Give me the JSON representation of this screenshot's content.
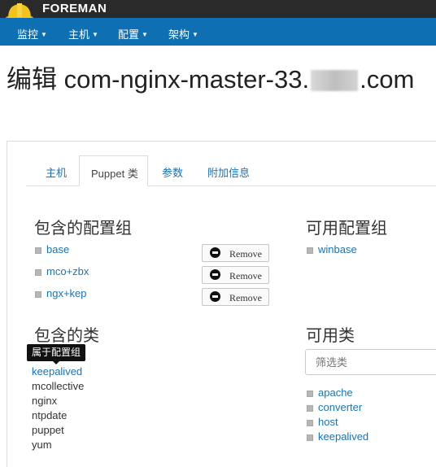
{
  "brand": {
    "name": "FOREMAN",
    "logo_icon": "hardhat-logo-icon"
  },
  "nav": {
    "items": [
      {
        "label": "监控"
      },
      {
        "label": "主机"
      },
      {
        "label": "配置"
      },
      {
        "label": "架构"
      }
    ],
    "caret": "▼"
  },
  "page": {
    "title_prefix": "编辑 com-nginx-master-33.",
    "title_suffix": ".com"
  },
  "tabs": [
    {
      "label": "主机"
    },
    {
      "label": "Puppet 类",
      "active": true
    },
    {
      "label": "参数"
    },
    {
      "label": "附加信息"
    }
  ],
  "included_config_groups": {
    "heading": "包含的配置组",
    "items": [
      {
        "name": "base",
        "action": "Remove"
      },
      {
        "name": "mco+zbx",
        "action": "Remove"
      },
      {
        "name": "ngx+kep",
        "action": "Remove"
      }
    ]
  },
  "available_config_groups": {
    "heading": "可用配置组",
    "items": [
      {
        "name": "winbase"
      }
    ]
  },
  "included_classes": {
    "heading": "包含的类",
    "tooltip": "属于配置组",
    "items": [
      {
        "name": "keepalived",
        "linked": true
      },
      {
        "name": "mcollective"
      },
      {
        "name": "nginx"
      },
      {
        "name": "ntpdate"
      },
      {
        "name": "puppet"
      },
      {
        "name": "yum"
      }
    ]
  },
  "available_classes": {
    "heading": "可用类",
    "filter_placeholder": "筛选类",
    "items": [
      {
        "name": "apache"
      },
      {
        "name": "converter"
      },
      {
        "name": "host"
      },
      {
        "name": "keepalived"
      }
    ]
  },
  "colors": {
    "nav_bg": "#0e6fb3",
    "topbar_bg": "#2a2a2a",
    "link": "#1a73b8",
    "logo_yellow": "#f2c419"
  }
}
